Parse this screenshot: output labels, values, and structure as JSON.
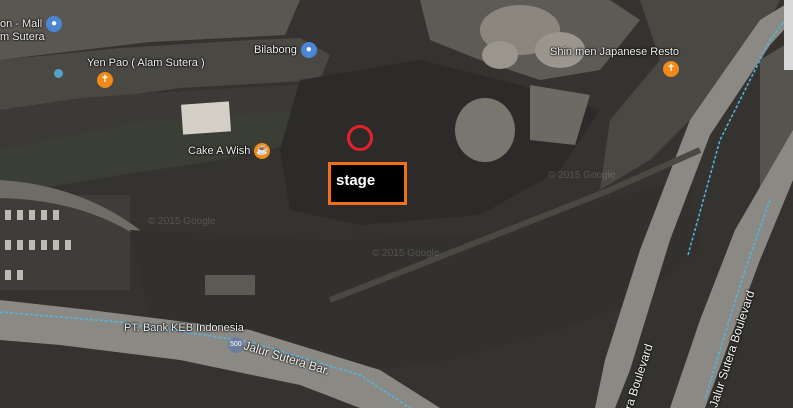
{
  "map": {
    "pois": [
      {
        "name": "on - Mall",
        "icon": "shopping-bag-icon"
      },
      {
        "name": "m Sutera",
        "icon": ""
      },
      {
        "name": "Yen Pao ( Alam Sutera )",
        "icon": "restaurant-icon"
      },
      {
        "name": "Bilabong",
        "icon": "shopping-bag-icon"
      },
      {
        "name": "Shin men Japanese Resto",
        "icon": "restaurant-icon"
      },
      {
        "name": "Cake A Wish",
        "icon": "cafe-icon"
      },
      {
        "name": "PT. Bank KEB Indonesia",
        "icon": "bank-icon"
      }
    ],
    "roads": {
      "jalur_sutera": "Jalur Sutera Bar.",
      "boulevard_left": "ra Boulevard",
      "boulevard_right": "Jalur Sutera Boulevard"
    },
    "watermarks": [
      "© 2015 Google",
      "© 2015 Google",
      "© 2015 Google"
    ],
    "annotation": {
      "label": "stage"
    },
    "colors": {
      "marker_circle": "#e8202a",
      "annotation_border": "#f26e1b",
      "annotation_fill": "#000000"
    }
  }
}
